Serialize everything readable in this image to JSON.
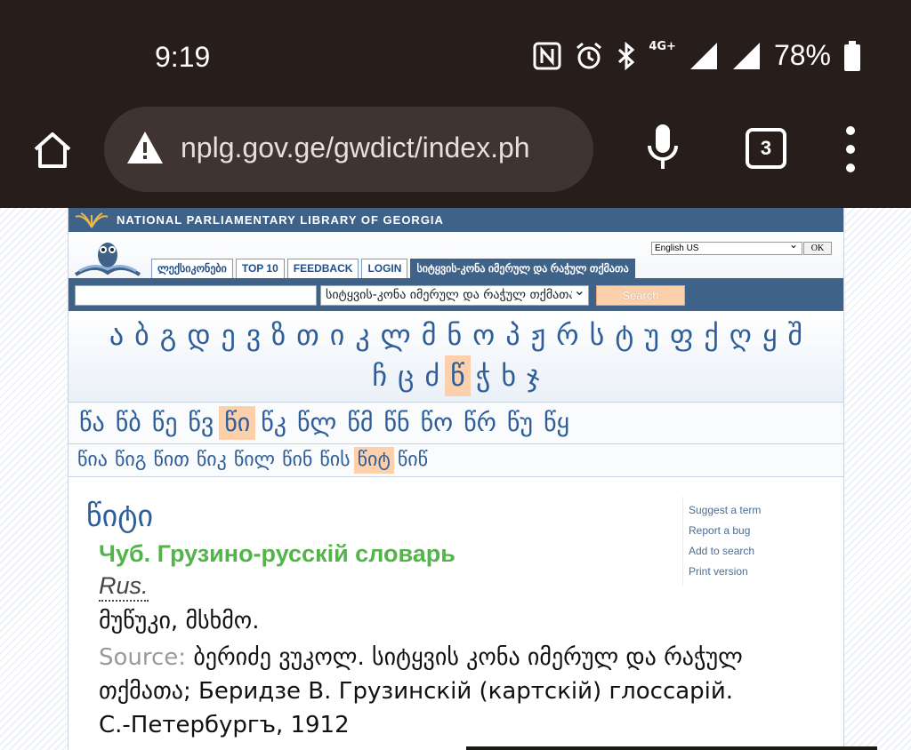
{
  "status_bar": {
    "time": "9:19",
    "network_label": "4G+",
    "battery": "78%",
    "icons": [
      "nfc-icon",
      "alarm-icon",
      "bluetooth-icon",
      "signal-icon",
      "battery-icon"
    ]
  },
  "browser": {
    "url": "nplg.gov.ge/gwdict/index.ph",
    "tab_count": "3"
  },
  "site": {
    "library_name": "NATIONAL PARLIAMENTARY LIBRARY OF GEORGIA",
    "language_select": "English US",
    "ok_label": "OK",
    "nav_tabs": [
      {
        "label": "ლექსიკონები"
      },
      {
        "label": "TOP 10"
      },
      {
        "label": "FEEDBACK"
      },
      {
        "label": "LOGIN"
      },
      {
        "label": "სიტყვის-კონა იმერულ და რაჭულ თქმათა"
      }
    ],
    "search": {
      "input_value": "",
      "dictionary_select": "სიტყვის-კონა იმერულ და რაჭულ თქმათა",
      "button_label": "Search"
    }
  },
  "alphabet": {
    "row1": [
      "ა",
      "ბ",
      "გ",
      "დ",
      "ე",
      "ვ",
      "ზ",
      "თ",
      "ი",
      "კ",
      "ლ",
      "მ",
      "ნ",
      "ო",
      "პ",
      "ჟ",
      "რ",
      "ს",
      "ტ",
      "უ",
      "ფ",
      "ქ",
      "ღ",
      "ყ",
      "შ"
    ],
    "row2": [
      "ჩ",
      "ც",
      "ძ",
      "წ",
      "ჭ",
      "ხ",
      "ჯ"
    ],
    "selected": "წ"
  },
  "syllables": {
    "items": [
      "წა",
      "წბ",
      "წე",
      "წვ",
      "წი",
      "წკ",
      "წლ",
      "წმ",
      "წნ",
      "წო",
      "წრ",
      "წუ",
      "წყ"
    ],
    "selected": "წი"
  },
  "subsyllables": {
    "items": [
      "წია",
      "წიგ",
      "წით",
      "წიკ",
      "წილ",
      "წინ",
      "წის",
      "წიტ",
      "წიწ"
    ],
    "selected": "წიტ"
  },
  "entry": {
    "headword": "წიტი",
    "dictionary": "Чуб. Грузино-русскій словарь",
    "language": "Rus.",
    "definition": "მუწუკი, მსხმო.",
    "source_label": "Source:",
    "source_text": "ბერიძე ვუკოლ. სიტყვის კონა იმერულ და რაჭულ თქმათა; Беридзе В. Грузинскій (картскій) глоссарій. С.-Петербургъ, 1912"
  },
  "side_links": [
    "Suggest a term",
    "Report a bug",
    "Add to search",
    "Print version"
  ]
}
